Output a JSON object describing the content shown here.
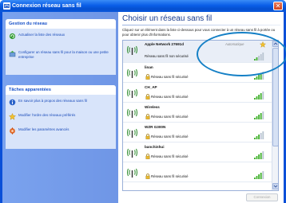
{
  "window": {
    "title": "Connexion réseau sans fil",
    "close_glyph": "✕"
  },
  "sidebar": {
    "network_tasks": {
      "title": "Gestion du réseau",
      "items": [
        {
          "label": "Actualiser la liste des réseaux",
          "icon": "refresh-icon"
        },
        {
          "label": "Configurer un réseau sans fil pour la maison ou une petite entreprise",
          "icon": "wizard-icon"
        }
      ]
    },
    "related_tasks": {
      "title": "Tâches apparentées",
      "items": [
        {
          "label": "En savoir plus à propos des réseaux sans fil",
          "icon": "info-icon"
        },
        {
          "label": "Modifier l'ordre des réseaux préférés",
          "icon": "star-icon"
        },
        {
          "label": "Modifier les paramètres avancés",
          "icon": "settings-icon"
        }
      ]
    }
  },
  "main": {
    "heading": "Choisir un réseau sans fil",
    "description": "Cliquez sur un élément dans la liste ci-dessous pour vous connecter à un réseau sans fil à portée ou pour obtenir plus d'informations.",
    "networks": [
      {
        "name": "Apple Network 27691d",
        "security": "Réseau sans fil non sécurisé",
        "auto_label": "Automatique",
        "secured": false,
        "signal": 0.4,
        "selected": true
      },
      {
        "name": "linan",
        "security": "Réseau sans fil sécurisé",
        "secured": true,
        "signal": 0.8
      },
      {
        "name": "CH_AP",
        "security": "Réseau sans fil sécurisé",
        "secured": true,
        "signal": 0.8
      },
      {
        "name": "Wireless",
        "security": "Réseau sans fil sécurisé",
        "secured": true,
        "signal": 0.8
      },
      {
        "name": "WZR G300N",
        "security": "Réseau sans fil sécurisé",
        "secured": true,
        "signal": 0.6
      },
      {
        "name": "banchinhui",
        "security": "Réseau sans fil sécurisé",
        "secured": true,
        "signal": 0.8
      },
      {
        "name": "",
        "security": "Réseau sans fil sécurisé",
        "secured": true,
        "signal": 0.8
      }
    ],
    "connect_label": "Connexion"
  },
  "colors": {
    "title_bar": "#0a5ee8",
    "task_pane": "#7aa2ee",
    "heading": "#1a3c8c",
    "callout": "#1580c6",
    "signal_on": "#3fb02a",
    "signal_off": "#b8c4d0"
  }
}
